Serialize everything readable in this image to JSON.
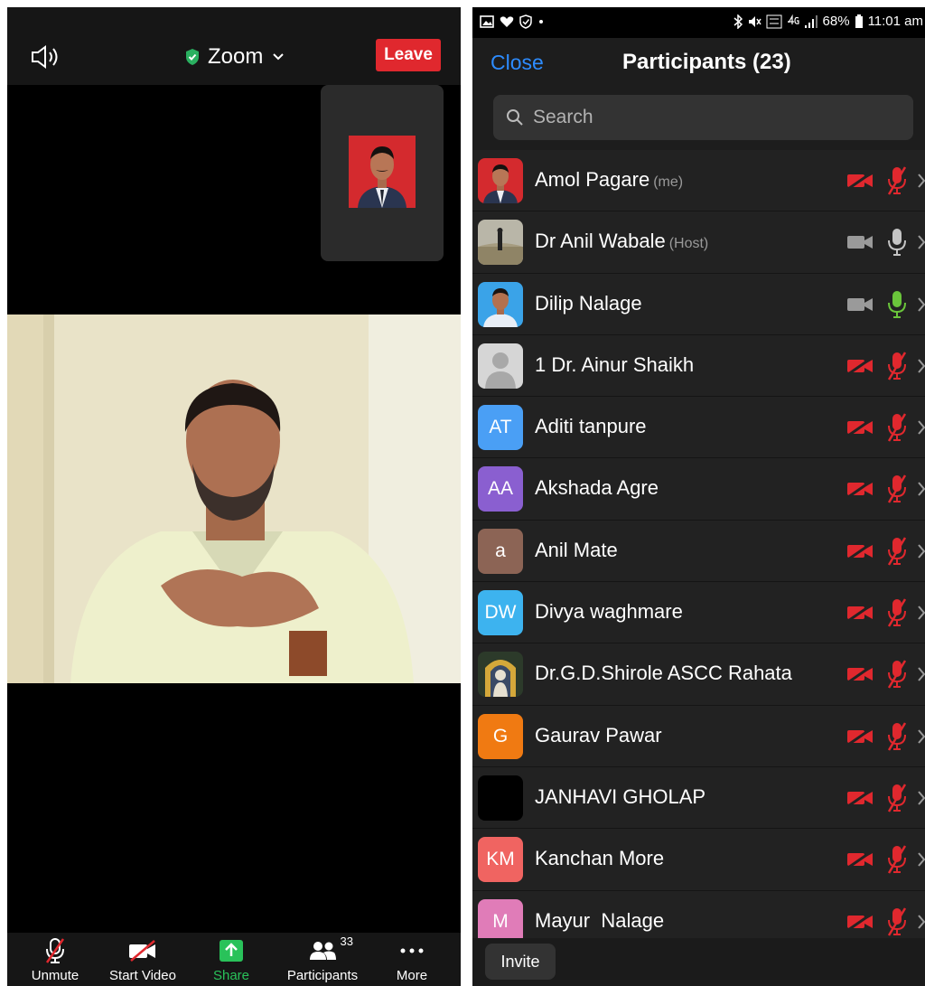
{
  "meeting": {
    "title": "Zoom",
    "leave_label": "Leave",
    "toolbar": {
      "unmute_label": "Unmute",
      "start_video_label": "Start Video",
      "share_label": "Share",
      "participants_label": "Participants",
      "participants_count": "33",
      "more_label": "More"
    }
  },
  "status_bar": {
    "battery": "68%",
    "time": "11:01 am"
  },
  "participants_panel": {
    "close_label": "Close",
    "title": "Participants (23)",
    "search_placeholder": "Search",
    "invite_label": "Invite",
    "participants": [
      {
        "name": "Amol Pagare",
        "tag": "(me)",
        "avatar_type": "photo",
        "avatar_icon": "man-red-bg-photo",
        "video": "off",
        "mic": "muted"
      },
      {
        "name": "Dr Anil Wabale",
        "tag": "(Host)",
        "avatar_type": "photo",
        "avatar_icon": "landscape-photo",
        "video": "off-gray",
        "mic": "unmuted"
      },
      {
        "name": "Dilip Nalage",
        "tag": "",
        "avatar_type": "photo",
        "avatar_icon": "man-blue-bg-photo",
        "video": "off-gray",
        "mic": "speaking"
      },
      {
        "name": "1 Dr. Ainur Shaikh",
        "tag": "",
        "avatar_type": "default",
        "avatar_icon": "default-user-icon",
        "video": "off",
        "mic": "muted"
      },
      {
        "name": "Aditi tanpure",
        "tag": "",
        "avatar_type": "initials",
        "initials": "AT",
        "color": "#4a9ff5",
        "video": "off",
        "mic": "muted"
      },
      {
        "name": "Akshada Agre",
        "tag": "",
        "avatar_type": "initials",
        "initials": "AA",
        "color": "#8a5fd0",
        "video": "off",
        "mic": "muted"
      },
      {
        "name": "Anil Mate",
        "tag": "",
        "avatar_type": "initials",
        "initials": "a",
        "color": "#8c6455",
        "video": "off",
        "mic": "muted"
      },
      {
        "name": "Divya waghmare",
        "tag": "",
        "avatar_type": "initials",
        "initials": "DW",
        "color": "#3db3ef",
        "video": "off",
        "mic": "muted"
      },
      {
        "name": "Dr.G.D.Shirole ASCC Rahata",
        "tag": "",
        "avatar_type": "photo",
        "avatar_icon": "shrine-photo",
        "video": "off",
        "mic": "muted"
      },
      {
        "name": "Gaurav Pawar",
        "tag": "",
        "avatar_type": "initials",
        "initials": "G",
        "color": "#f07a12",
        "video": "off",
        "mic": "muted"
      },
      {
        "name": "JANHAVI GHOLAP",
        "tag": "",
        "avatar_type": "initials",
        "initials": "",
        "color": "#000000",
        "video": "off",
        "mic": "muted"
      },
      {
        "name": "Kanchan More",
        "tag": "",
        "avatar_type": "initials",
        "initials": "KM",
        "color": "#f06461",
        "video": "off",
        "mic": "muted"
      },
      {
        "name": "Mayur  Nalage",
        "tag": "",
        "avatar_type": "initials",
        "initials": "M",
        "color": "#e07cb8",
        "video": "off",
        "mic": "muted"
      }
    ]
  },
  "colors": {
    "accent_blue": "#2d8cff",
    "leave_red": "#e0282e",
    "muted_red": "#e0282e",
    "share_green": "#29c25a",
    "speaking_green": "#6ac53b"
  }
}
